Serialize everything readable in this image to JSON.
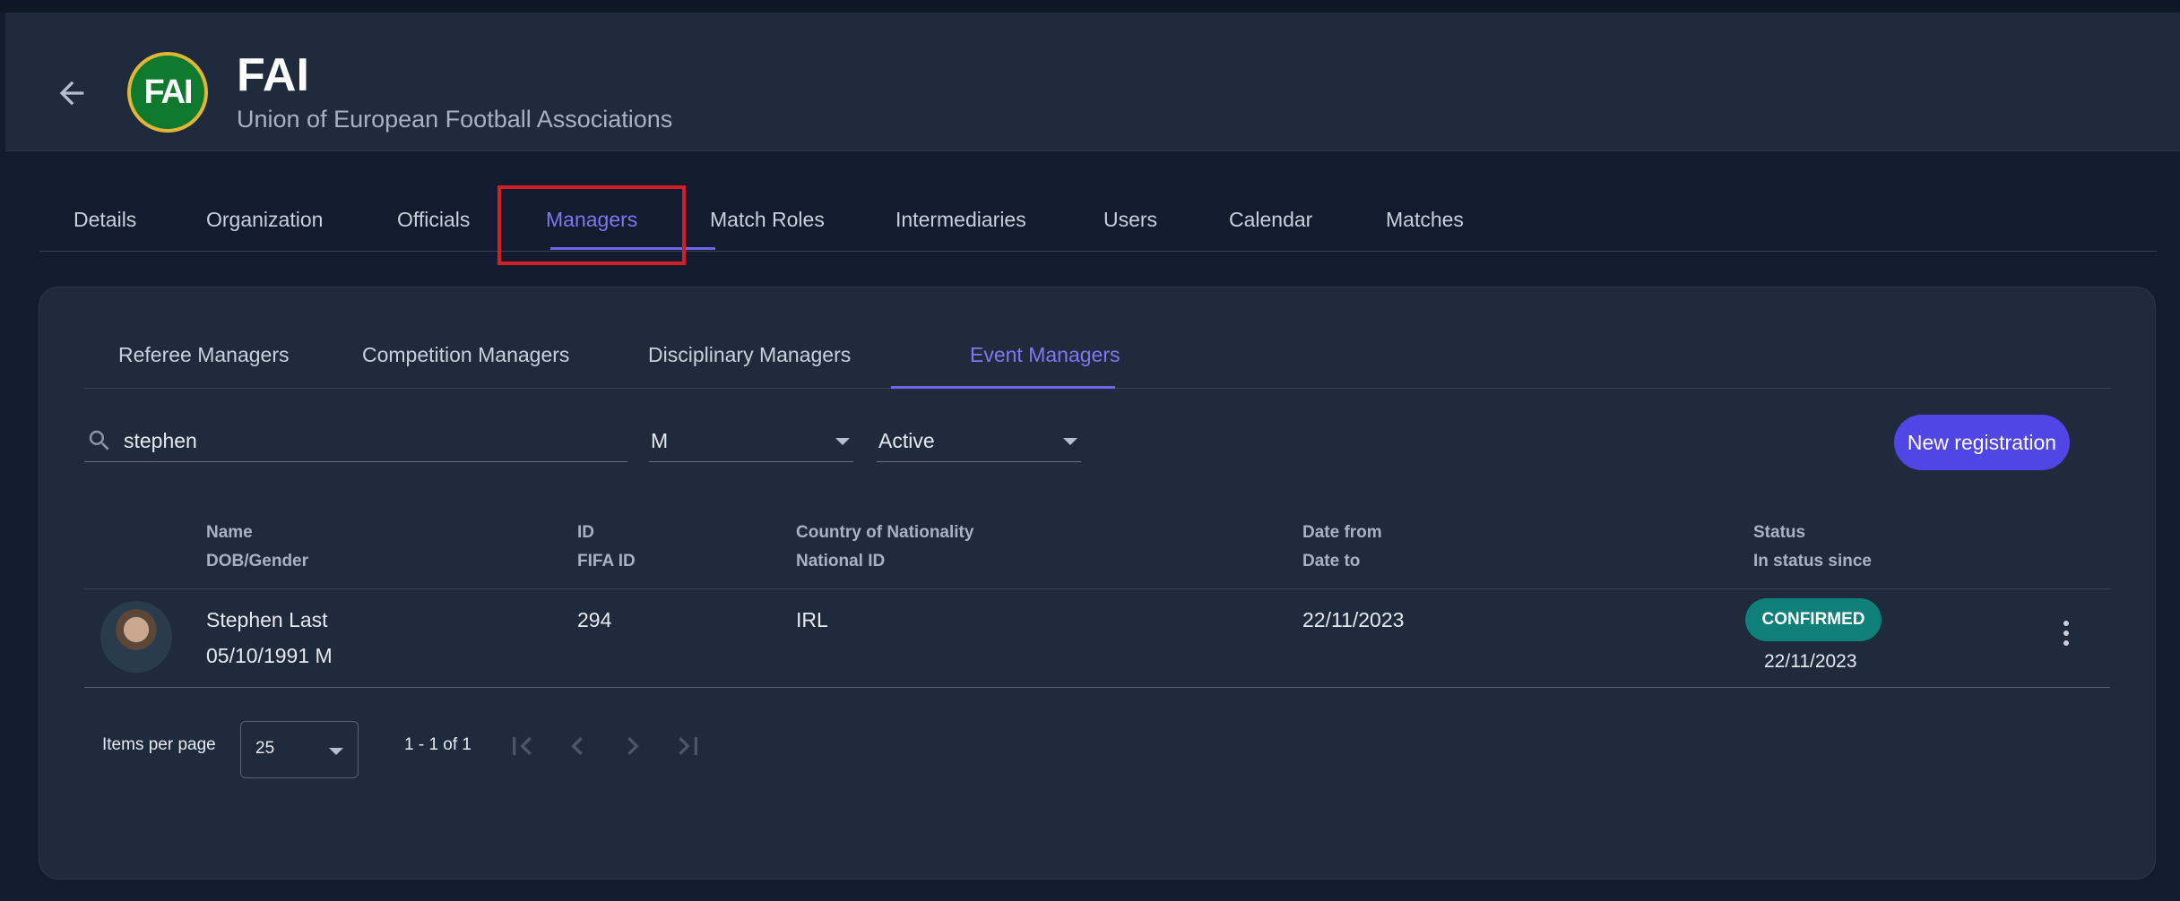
{
  "org": {
    "logo_text": "FAI",
    "title": "FAI",
    "subtitle": "Union of European Football Associations"
  },
  "tabs": [
    {
      "label": "Details"
    },
    {
      "label": "Organization"
    },
    {
      "label": "Officials"
    },
    {
      "label": "Managers"
    },
    {
      "label": "Match Roles"
    },
    {
      "label": "Intermediaries"
    },
    {
      "label": "Users"
    },
    {
      "label": "Calendar"
    },
    {
      "label": "Matches"
    }
  ],
  "subtabs": [
    {
      "label": "Referee Managers"
    },
    {
      "label": "Competition Managers"
    },
    {
      "label": "Disciplinary Managers"
    },
    {
      "label": "Event Managers"
    }
  ],
  "filters": {
    "search_value": "stephen",
    "gender_value": "M",
    "status_value": "Active"
  },
  "new_registration_label": "New registration",
  "table": {
    "headers": {
      "name": "Name",
      "dob_gender": "DOB/Gender",
      "id": "ID",
      "fifa_id": "FIFA ID",
      "country": "Country of Nationality",
      "national_id": "National ID",
      "date_from": "Date from",
      "date_to": "Date to",
      "status": "Status",
      "status_since": "In status since"
    },
    "rows": [
      {
        "name": "Stephen Last",
        "dob_gender": "05/10/1991 M",
        "id": "294",
        "country": "IRL",
        "date_from": "22/11/2023",
        "status": "CONFIRMED",
        "status_since": "22/11/2023"
      }
    ]
  },
  "pagination": {
    "items_per_page_label": "Items per page",
    "items_per_page_value": "25",
    "range_label": "1 - 1 of 1"
  },
  "colors": {
    "accent": "#4f46e5",
    "active_tab": "#7c78f0",
    "status_confirmed": "#0f8079",
    "highlight_box": "#d21f26"
  }
}
